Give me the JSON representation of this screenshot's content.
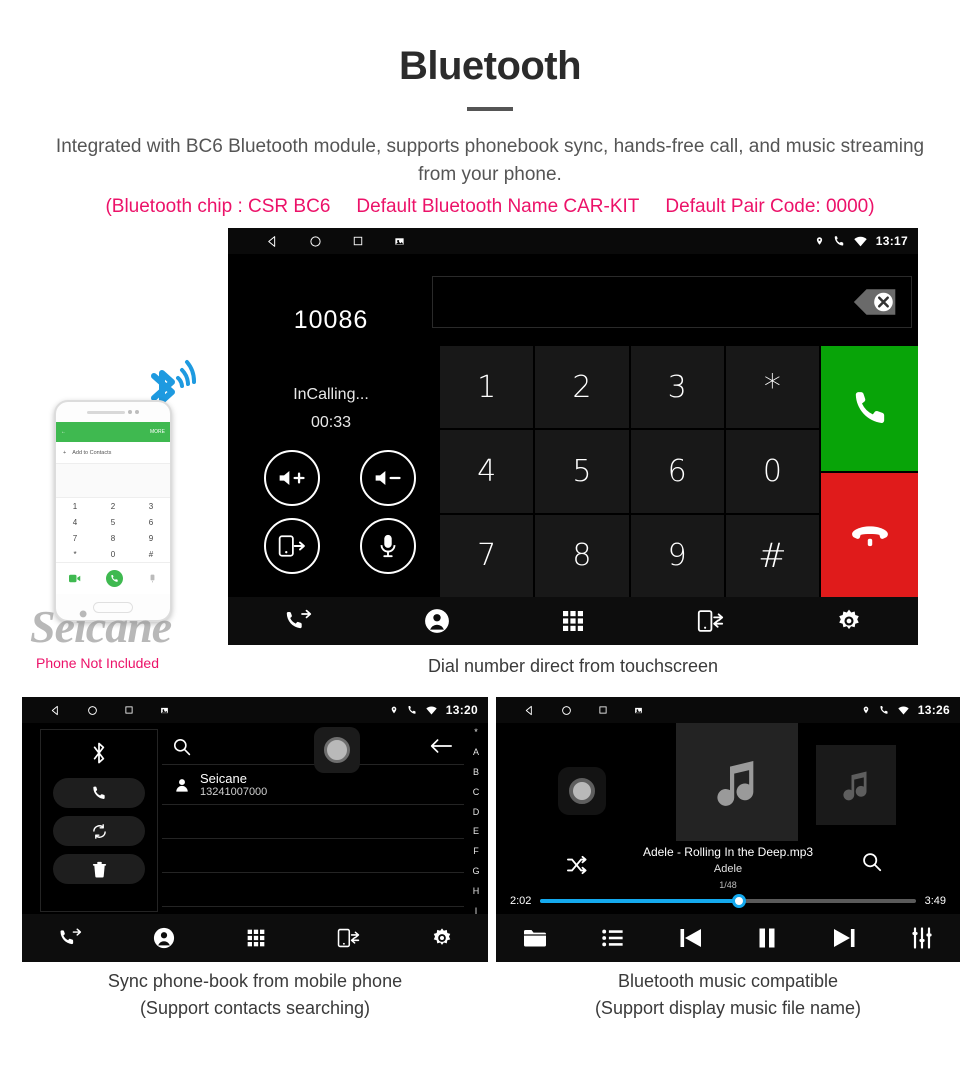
{
  "header": {
    "title": "Bluetooth",
    "subtitle": "Integrated with BC6 Bluetooth module, supports phonebook sync, hands-free call, and music streaming from your phone.",
    "spec_chip": "(Bluetooth chip : CSR BC6",
    "spec_name": "Default Bluetooth Name CAR-KIT",
    "spec_pair": "Default Pair Code: 0000)",
    "accent_color": "#ec1269",
    "title_color": "#2b2b2b"
  },
  "main_unit": {
    "status": {
      "time": "13:17",
      "icons": [
        "back-icon",
        "home-icon",
        "recents-icon",
        "screenshot-icon",
        "location-icon",
        "phone-icon",
        "wifi-icon"
      ]
    },
    "dial_number": "10086",
    "call_state": "InCalling...",
    "call_timer": "00:33",
    "input_value": "",
    "controls": [
      {
        "name": "volume-up-button",
        "label": "volume-up-icon"
      },
      {
        "name": "volume-down-button",
        "label": "volume-down-icon"
      },
      {
        "name": "transfer-to-phone-button",
        "label": "phone-transfer-icon"
      },
      {
        "name": "mute-microphone-button",
        "label": "microphone-icon"
      }
    ],
    "keys": [
      "1",
      "2",
      "3",
      "*",
      "4",
      "5",
      "6",
      "0",
      "7",
      "8",
      "9",
      "#"
    ],
    "call_button": "call-icon",
    "hangup_button": "hangup-icon",
    "call_color": "#08a408",
    "hangup_color": "#e01b1b",
    "toolbar": [
      "call-history-icon",
      "contacts-icon",
      "dialpad-icon",
      "phone-sync-icon",
      "settings-icon"
    ]
  },
  "phone_mock": {
    "appbar_back": "←",
    "appbar_more": "MORE",
    "add_to_contacts": "Add to Contacts",
    "keys": [
      "1",
      "2",
      "3",
      "4",
      "5",
      "6",
      "7",
      "8",
      "9",
      "*",
      "0",
      "#"
    ],
    "not_included_note": "Phone Not Included",
    "watermark": "Seicane"
  },
  "captions": {
    "main": "Dial number direct from touchscreen",
    "left_line1": "Sync phone-book from mobile phone",
    "left_line2": "(Support contacts searching)",
    "right_line1": "Bluetooth music compatible",
    "right_line2": "(Support display music file name)"
  },
  "phonebook_unit": {
    "status": {
      "time": "13:20"
    },
    "sidebar": [
      "bluetooth-icon",
      "call-icon",
      "sync-icon",
      "delete-icon"
    ],
    "search_placeholder": "",
    "contact": {
      "name": "Seicane",
      "number": "13241007000"
    },
    "alphabet_index": [
      "*",
      "A",
      "B",
      "C",
      "D",
      "E",
      "F",
      "G",
      "H",
      "I"
    ],
    "toolbar": [
      "call-history-icon",
      "contacts-icon",
      "dialpad-icon",
      "phone-sync-icon",
      "settings-icon"
    ]
  },
  "music_unit": {
    "status": {
      "time": "13:26"
    },
    "track_title": "Adele - Rolling In the Deep.mp3",
    "artist": "Adele",
    "track_index": "1/48",
    "elapsed": "2:02",
    "duration": "3:49",
    "progress_percent": 53,
    "progress_color": "#14a9ee",
    "controls": [
      "folder-icon",
      "playlist-icon",
      "previous-icon",
      "pause-icon",
      "next-icon",
      "equalizer-icon"
    ]
  }
}
